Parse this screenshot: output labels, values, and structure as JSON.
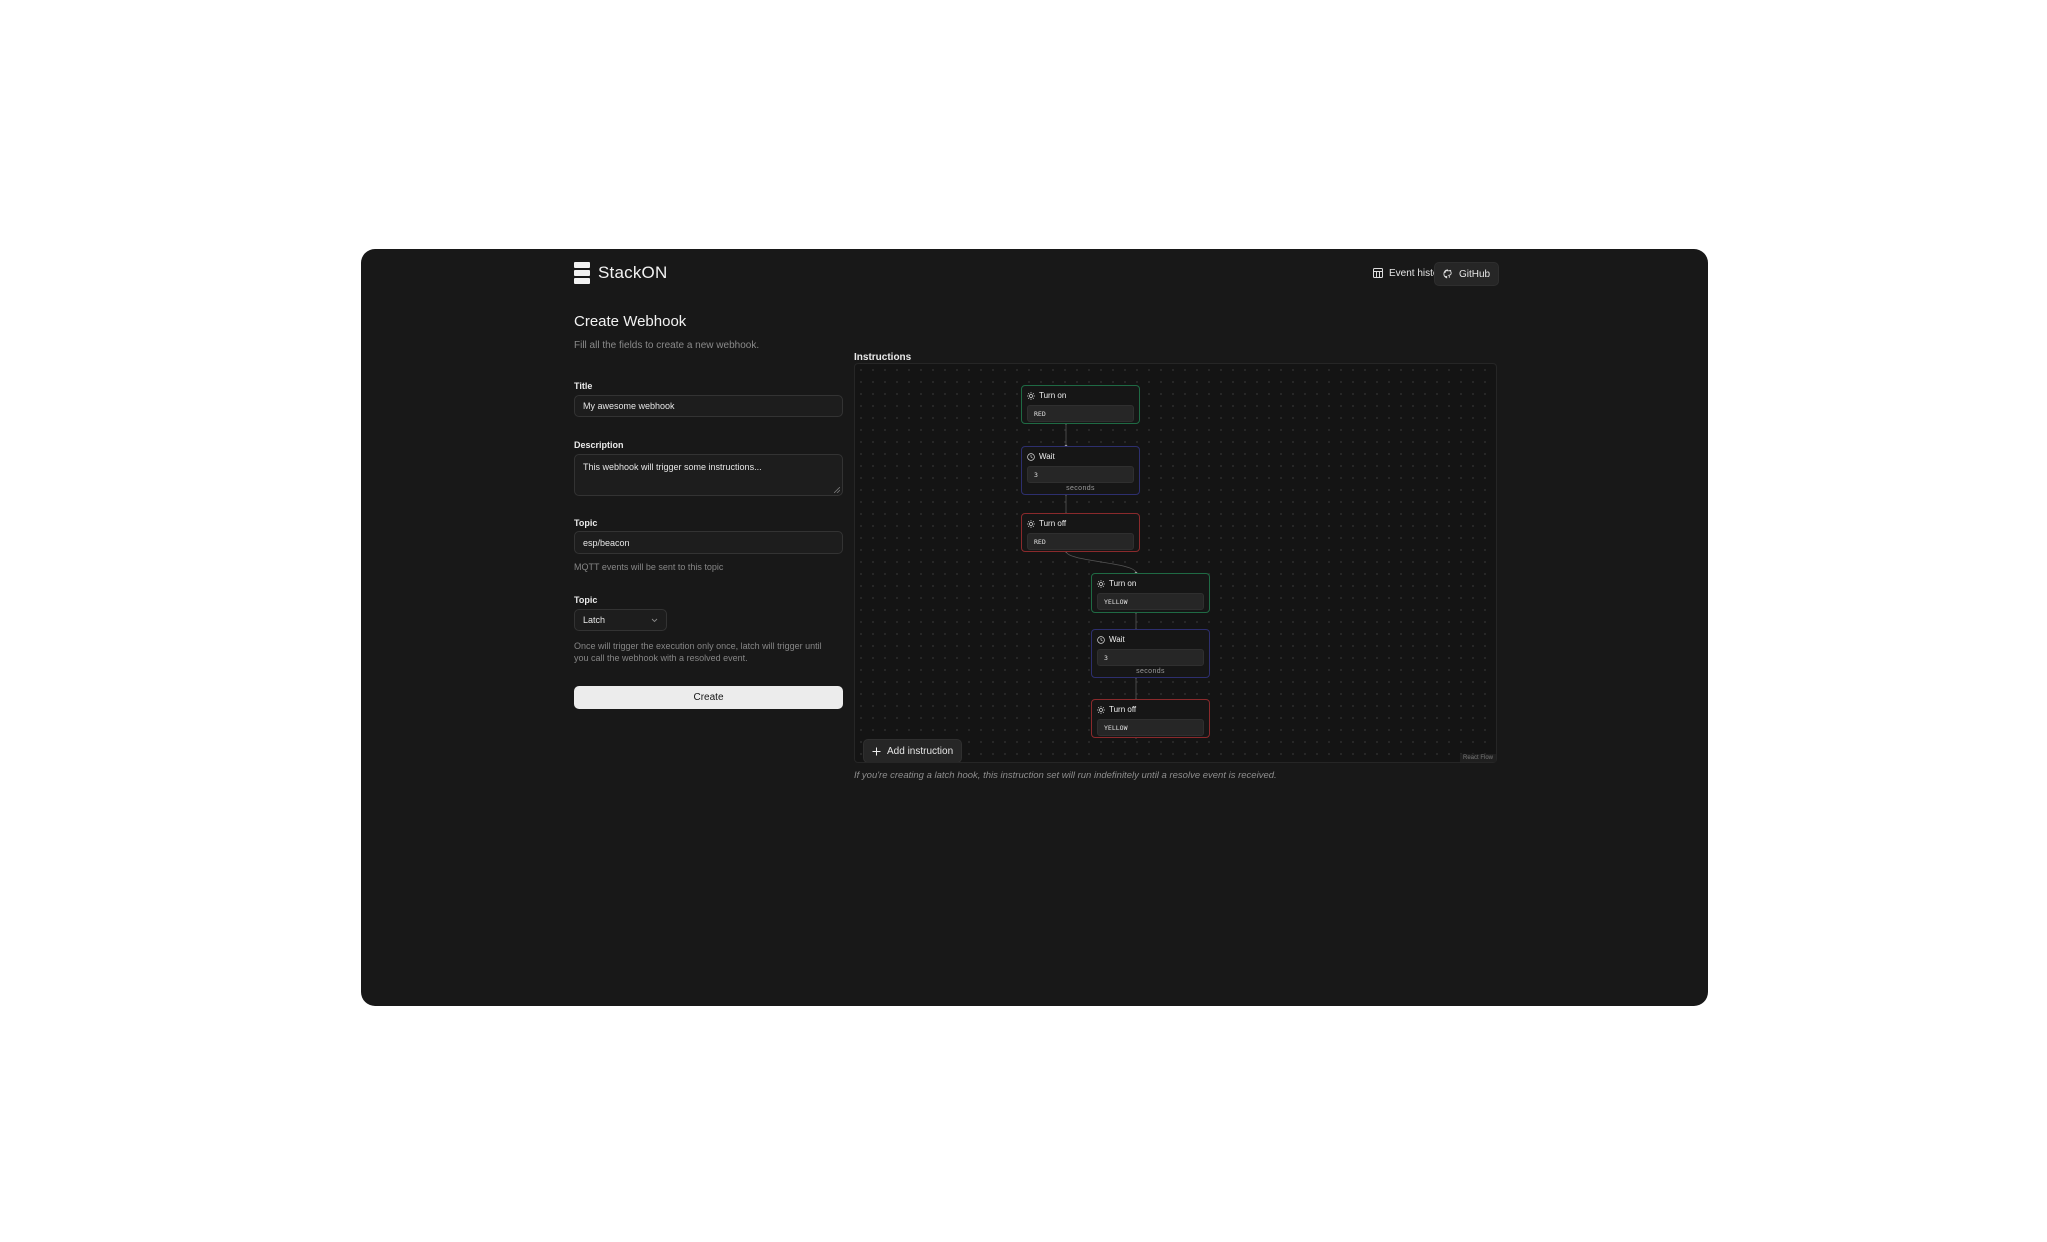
{
  "app": {
    "name": "StackON"
  },
  "header": {
    "event_history": "Event history",
    "github": "GitHub"
  },
  "page": {
    "title": "Create Webhook",
    "subtitle": "Fill all the fields to create a new webhook."
  },
  "form": {
    "title_label": "Title",
    "title_value": "My awesome webhook",
    "description_label": "Description",
    "description_value": "This webhook will trigger some instructions...",
    "topic_label": "Topic",
    "topic_value": "esp/beacon",
    "topic_hint": "MQTT events will be sent to this topic",
    "mode_label": "Topic",
    "mode_value": "Latch",
    "mode_hint_line1": "Once will trigger the execution only once, latch will trigger until",
    "mode_hint_line2": "you call the webhook with a resolved event.",
    "create_label": "Create"
  },
  "instructions": {
    "title": "Instructions",
    "add_label": "Add instruction",
    "footnote": "If you're creating a latch hook, this instruction set will run indefinitely until a resolve event is received.",
    "badge": "React Flow",
    "nodes": [
      {
        "type": "Turn on",
        "value": "RED",
        "icon": "sun-icon",
        "color": "#1f6a44"
      },
      {
        "type": "Wait",
        "value": "3",
        "unit": "seconds",
        "icon": "clock-icon",
        "color": "#2d2f6e"
      },
      {
        "type": "Turn off",
        "value": "RED",
        "icon": "sun-icon",
        "color": "#8a2a2c"
      },
      {
        "type": "Turn on",
        "value": "YELLOW",
        "icon": "sun-icon",
        "color": "#1f6a44"
      },
      {
        "type": "Wait",
        "value": "3",
        "unit": "seconds",
        "icon": "clock-icon",
        "color": "#2d2f6e"
      },
      {
        "type": "Turn off",
        "value": "YELLOW",
        "icon": "sun-icon",
        "color": "#8a2a2c"
      }
    ]
  }
}
